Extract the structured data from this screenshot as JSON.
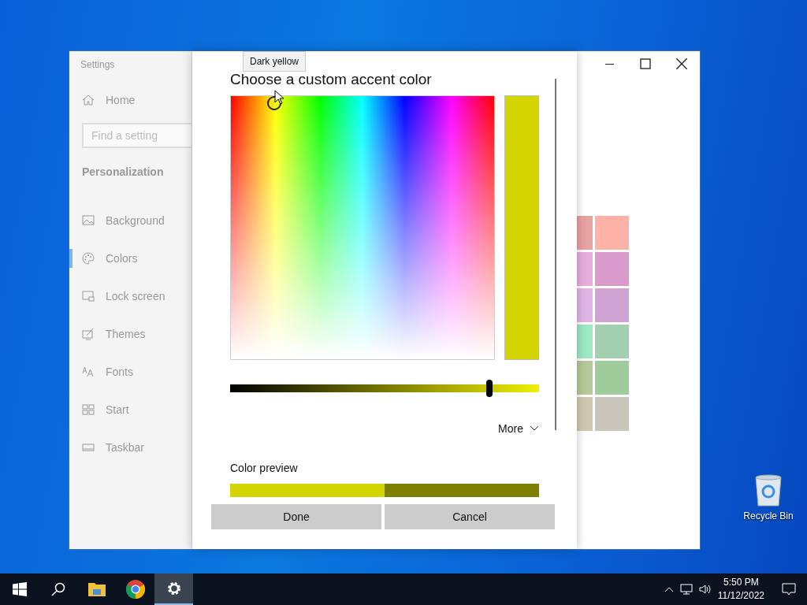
{
  "settings_window": {
    "title": "Settings",
    "home": "Home",
    "search": {
      "placeholder": "Find a setting"
    },
    "section": "Personalization",
    "items": [
      {
        "label": "Background",
        "selected": false
      },
      {
        "label": "Colors",
        "selected": true
      },
      {
        "label": "Lock screen",
        "selected": false
      },
      {
        "label": "Themes",
        "selected": false
      },
      {
        "label": "Fonts",
        "selected": false
      },
      {
        "label": "Start",
        "selected": false
      },
      {
        "label": "Taskbar",
        "selected": false
      }
    ],
    "swatches": [
      {
        "color": "#e8a3a3"
      },
      {
        "color": "#ffb3a8"
      },
      {
        "color": "#e6aedd"
      },
      {
        "color": "#d89bcc"
      },
      {
        "color": "#dfb6e6"
      },
      {
        "color": "#cfa3d4"
      },
      {
        "color": "#9ee8c4"
      },
      {
        "color": "#a1cfb0"
      },
      {
        "color": "#b5c99a"
      },
      {
        "color": "#a0cc9c"
      },
      {
        "color": "#d1c8b2"
      },
      {
        "color": "#c9c5bb"
      }
    ]
  },
  "dialog": {
    "title": "Choose a custom accent color",
    "tooltip": "Dark yellow",
    "brightness": {
      "level": 0.84
    },
    "more": "More",
    "preview_label": "Color preview",
    "preview": [
      {
        "color": "#d4d400"
      },
      {
        "color": "#7f7f00"
      }
    ],
    "buttons": [
      "Done",
      "Cancel"
    ]
  },
  "desktop_icons": [
    {
      "label": "Recycle Bin"
    }
  ],
  "taskbar": {
    "apps": [
      {
        "kind": "start",
        "selected": false
      },
      {
        "kind": "search",
        "selected": false
      },
      {
        "kind": "folder",
        "selected": false
      },
      {
        "kind": "browser",
        "selected": false
      },
      {
        "kind": "settings",
        "selected": true
      }
    ],
    "time": "5:50 PM",
    "date": "11/12/2022"
  }
}
